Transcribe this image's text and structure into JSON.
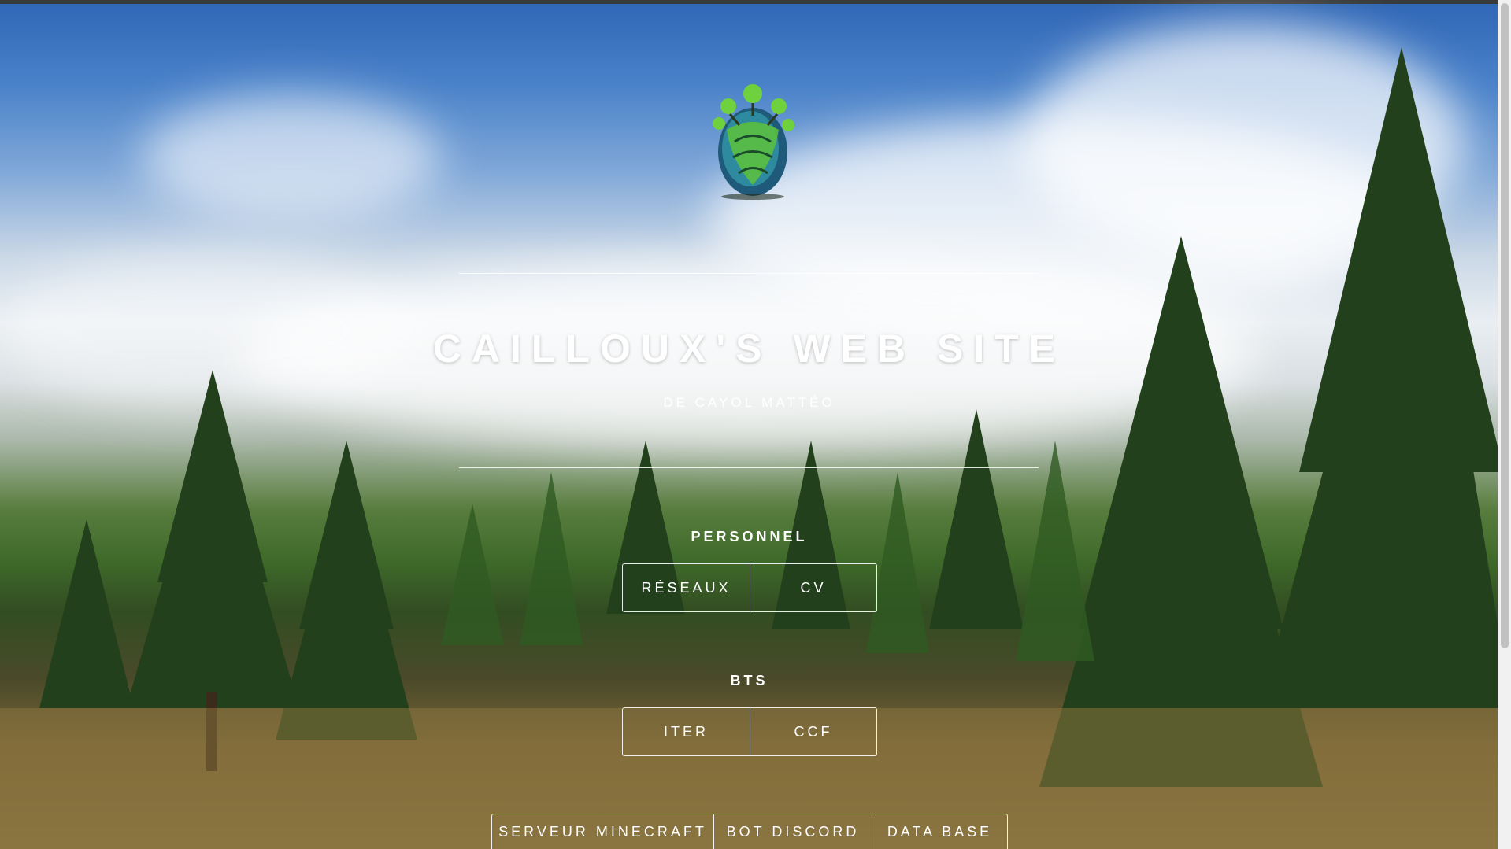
{
  "header": {
    "title": "CAILLOUX'S WEB SITE",
    "subtitle": "DE CAYOL MATTÉO"
  },
  "sections": [
    {
      "title": "PERSONNEL",
      "buttons": [
        "RÉSEAUX",
        "CV"
      ]
    },
    {
      "title": "BTS",
      "buttons": [
        "ITER",
        "CCF"
      ]
    },
    {
      "title": "",
      "buttons": [
        "SERVEUR MINECRAFT",
        "BOT DISCORD",
        "DATA BASE"
      ]
    }
  ],
  "colors": {
    "text": "#ffffff",
    "sky": "#3f76c2",
    "forest": "#3d6a2a"
  }
}
